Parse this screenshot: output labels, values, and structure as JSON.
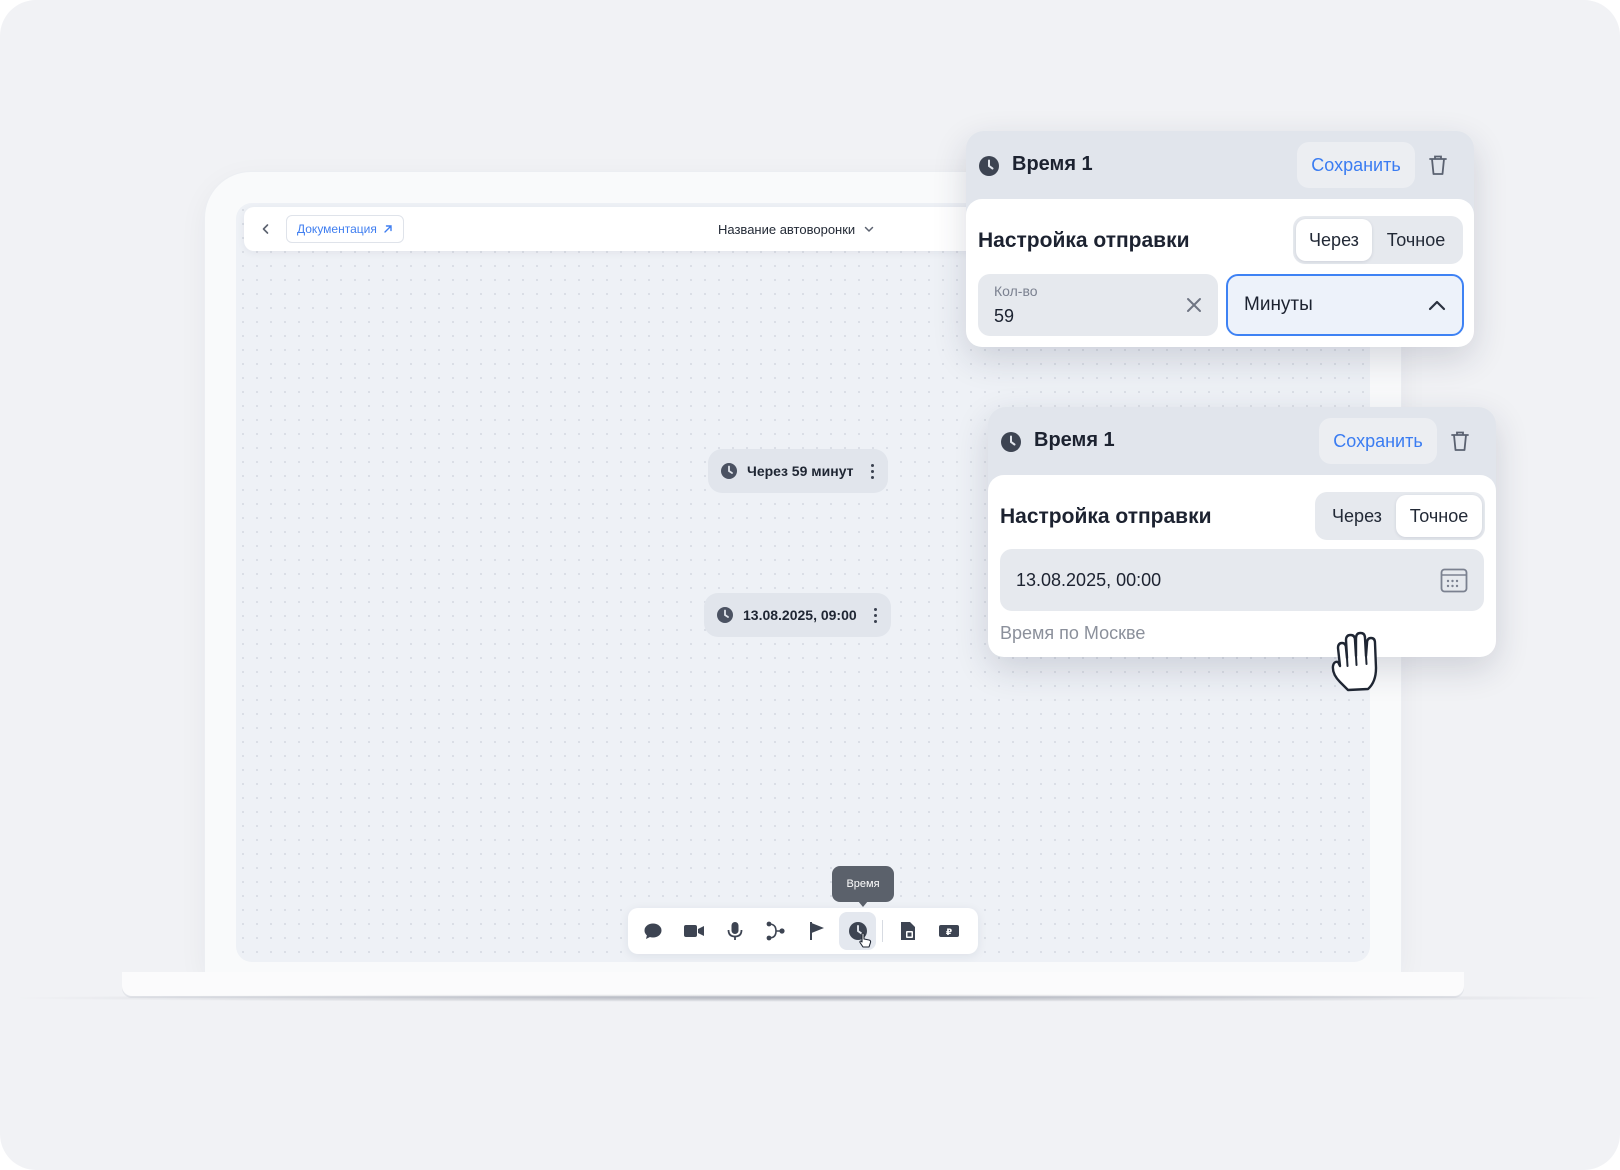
{
  "canvas": {
    "topbar": {
      "doc_link_label": "Документация",
      "funnel_name": "Название автоворонки"
    },
    "nodes": [
      {
        "label": "Через 59 минут"
      },
      {
        "label": "13.08.2025, 09:00"
      }
    ],
    "toolbar": {
      "tooltip": "Время",
      "tools": [
        "chat-icon",
        "video-icon",
        "microphone-icon",
        "branch-icon",
        "flag-icon",
        "clock-icon",
        "document-icon",
        "payment-icon"
      ],
      "active_tool": "clock-icon"
    }
  },
  "popup_relative": {
    "title": "Время 1",
    "save_label": "Сохранить",
    "section_title": "Настройка отправки",
    "segments": [
      "Через",
      "Точное"
    ],
    "active_segment": "Через",
    "quantity_label": "Кол-во",
    "quantity_value": "59",
    "unit_value": "Минуты"
  },
  "popup_exact": {
    "title": "Время 1",
    "save_label": "Сохранить",
    "section_title": "Настройка отправки",
    "segments": [
      "Через",
      "Точное"
    ],
    "active_segment": "Точное",
    "datetime_value": "13.08.2025, 00:00",
    "timezone_note": "Время по Москве"
  },
  "colors": {
    "accent": "#3a7cf2",
    "popup_header": "#e1e5ec",
    "canvas": "#eef1f6"
  }
}
